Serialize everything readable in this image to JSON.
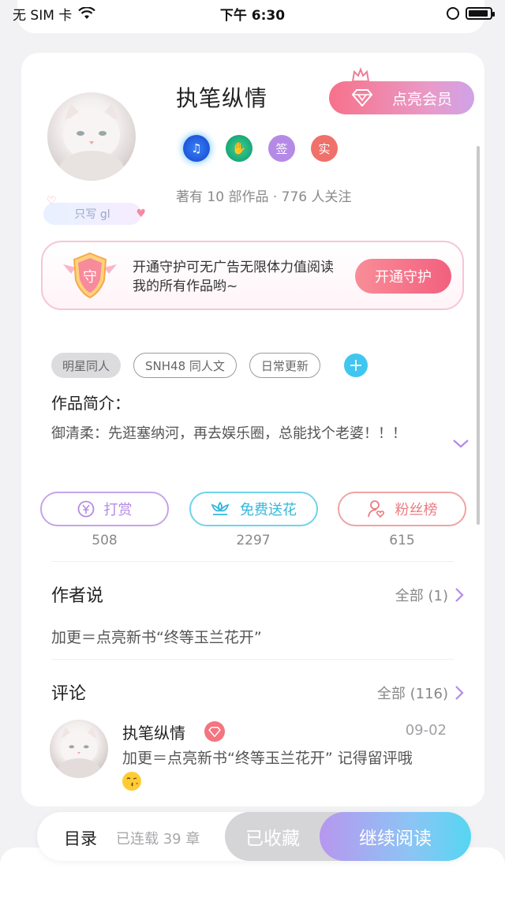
{
  "status_bar": {
    "carrier": "无 SIM 卡",
    "time": "下午 6:30"
  },
  "author": {
    "name": "执笔纵情",
    "signature": "只写 gl",
    "stats": "著有 10 部作品 · 776 人关注",
    "badges": [
      "music-badge-icon",
      "handshake-badge-icon",
      "签",
      "实"
    ],
    "vip_button": "点亮会员"
  },
  "guard": {
    "shield_char": "守",
    "text": "开通守护可无广告无限体力值阅读我的所有作品哟~",
    "button": "开通守护"
  },
  "tags": [
    "明星同人",
    "SNH48 同人文",
    "日常更新"
  ],
  "tag_add": "+",
  "intro": {
    "title": "作品简介：",
    "body": "御清柔：先逛塞纳河，再去娱乐圈，总能找个老婆！！！"
  },
  "actions": [
    {
      "label": "打赏",
      "count": "508"
    },
    {
      "label": "免费送花",
      "count": "2297"
    },
    {
      "label": "粉丝榜",
      "count": "615"
    }
  ],
  "author_says": {
    "title": "作者说",
    "more": "全部 (1)",
    "text": "加更＝点亮新书“终等玉兰花开”"
  },
  "comments": {
    "title": "评论",
    "more": "全部 (116)",
    "items": [
      {
        "name": "执笔纵情",
        "date": "09-02",
        "text": "加更＝点亮新书“终等玉兰花开” 记得留评哦"
      }
    ]
  },
  "bottom_bar": {
    "toc": "目录",
    "serial": "已连载 39 章",
    "collected": "已收藏",
    "continue": "继续阅读"
  },
  "colors": {
    "vip_gradient_start": "#f7718a",
    "reward": "#b58ae6",
    "flower": "#35b7db",
    "fans": "#ec7c80",
    "read_gradient_end": "#55d6f2"
  }
}
